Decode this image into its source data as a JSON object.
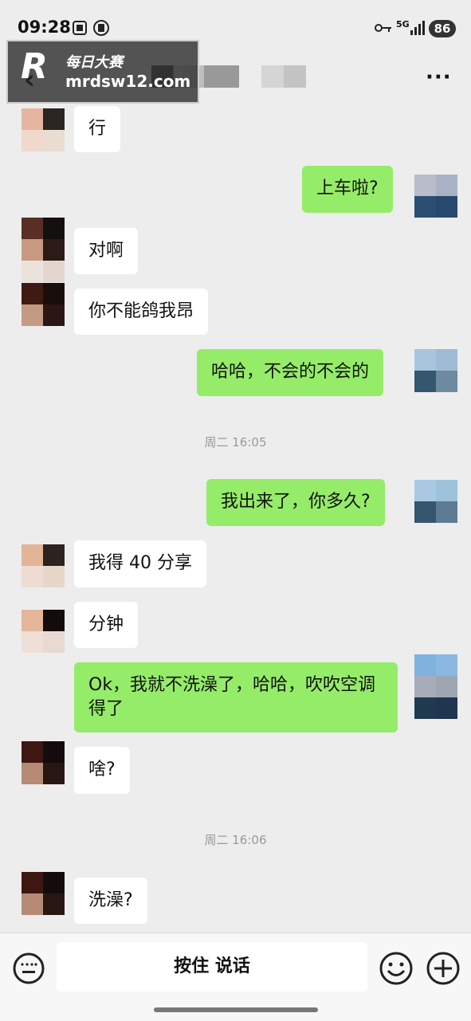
{
  "status_bar": {
    "time": "09:28",
    "network": "5G",
    "battery": "86"
  },
  "watermark": {
    "logo": "R",
    "title": "每日大赛",
    "url": "mrdsw12.com"
  },
  "header": {
    "more_label": "···"
  },
  "messages": [
    {
      "text": "行"
    },
    {
      "text": "上车啦?"
    },
    {
      "text": "对啊"
    },
    {
      "text": "你不能鸽我昂"
    },
    {
      "text": "哈哈，不会的不会的"
    },
    {
      "text": "我出来了，你多久?"
    },
    {
      "text": "我得 40 分享"
    },
    {
      "text": "分钟"
    },
    {
      "text": "Ok，我就不洗澡了，哈哈，吹吹空调得了"
    },
    {
      "text": "啥?"
    },
    {
      "text": "洗澡?"
    }
  ],
  "timestamps": [
    "周二 16:05",
    "周二 16:06"
  ],
  "input_bar": {
    "voice_label": "按住 说话",
    "keyboard_icon": "keyboard-icon",
    "emoji_icon": "emoji-icon",
    "plus_icon": "plus-icon"
  },
  "colors": {
    "sent_bubble": "#95ec69",
    "received_bubble": "#ffffff",
    "background": "#ededed"
  }
}
